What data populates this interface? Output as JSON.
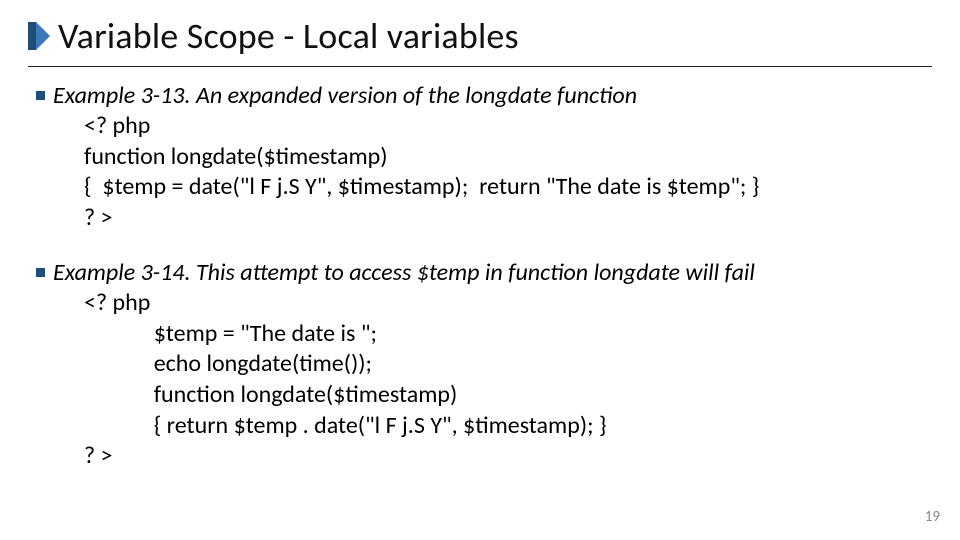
{
  "title": "Variable Scope - Local variables",
  "pageNumber": "19",
  "examples": [
    {
      "title": "Example 3-13. An expanded version of the longdate function",
      "code": [
        "<? php",
        "function longdate($timestamp)",
        "{  $temp = date(\"l F j.S Y\", $timestamp);  return \"The date is $temp\"; }",
        "? >"
      ]
    },
    {
      "title": "Example 3-14. This attempt to access $temp in function longdate will fail",
      "code": [
        "<? php",
        "    $temp = \"The date is \";",
        "    echo longdate(time());",
        "",
        "    function longdate($timestamp)",
        "    { return $temp . date(\"l F j.S Y\", $timestamp); }",
        "? >"
      ]
    }
  ]
}
